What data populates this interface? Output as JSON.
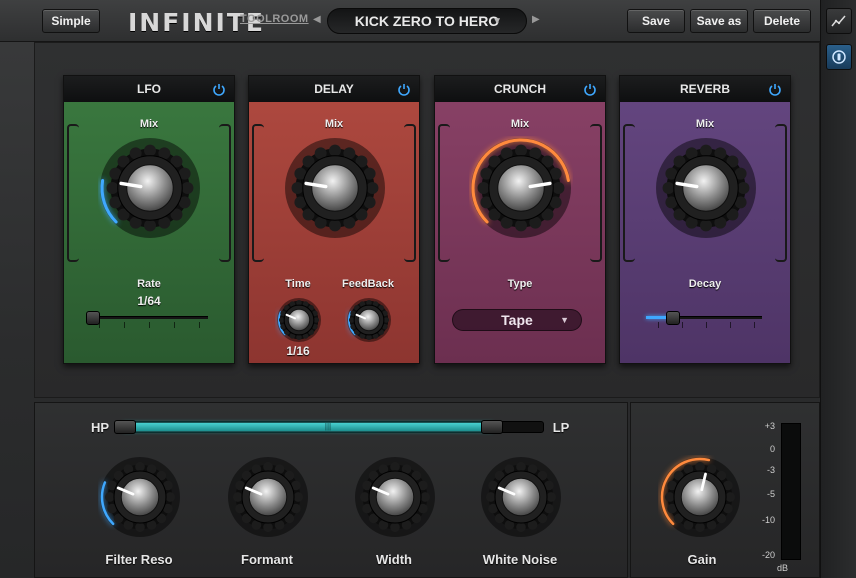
{
  "header": {
    "simple_label": "Simple",
    "logo_text": "INFINITE",
    "brand_text": "TOOLROOM",
    "preset_name": "KICK ZERO TO HERO",
    "prev_symbol": "◀",
    "next_symbol": "▶",
    "save_label": "Save",
    "save_as_label": "Save as",
    "delete_label": "Delete"
  },
  "side": {
    "graph_icon": "line-graph-icon",
    "info_icon": "circle-badge-icon"
  },
  "modules": {
    "lfo": {
      "title": "LFO",
      "mix_label": "Mix",
      "rate_label": "Rate",
      "rate_value": "1/64",
      "mix_value": 0.2,
      "rate_position": 0.0,
      "color": "#2f6b35"
    },
    "delay": {
      "title": "DELAY",
      "mix_label": "Mix",
      "time_label": "Time",
      "time_value": "1/16",
      "feedback_label": "FeedBack",
      "mix_value": 0.2,
      "color": "#a8413a"
    },
    "crunch": {
      "title": "CRUNCH",
      "mix_label": "Mix",
      "type_label": "Type",
      "type_value": "Tape",
      "mix_value": 0.8,
      "color": "#7d3a5c"
    },
    "reverb": {
      "title": "REVERB",
      "mix_label": "Mix",
      "decay_label": "Decay",
      "mix_value": 0.2,
      "decay_position": 0.25,
      "color": "#5a3d72"
    }
  },
  "bottom": {
    "hp_label": "HP",
    "lp_label": "LP",
    "range_start": 0.0,
    "range_end": 0.84,
    "knobs": [
      {
        "label": "Filter Reso"
      },
      {
        "label": "Formant"
      },
      {
        "label": "Width"
      },
      {
        "label": "White Noise"
      }
    ],
    "gain_label": "Gain",
    "db_scale": [
      "+3",
      "0",
      "-3",
      "-5",
      "-10",
      "-20"
    ],
    "db_unit": "dB"
  },
  "colors": {
    "accent_blue": "#3fa8ff",
    "accent_orange": "#ff8a3d",
    "range_teal": "#2fb3b3"
  }
}
